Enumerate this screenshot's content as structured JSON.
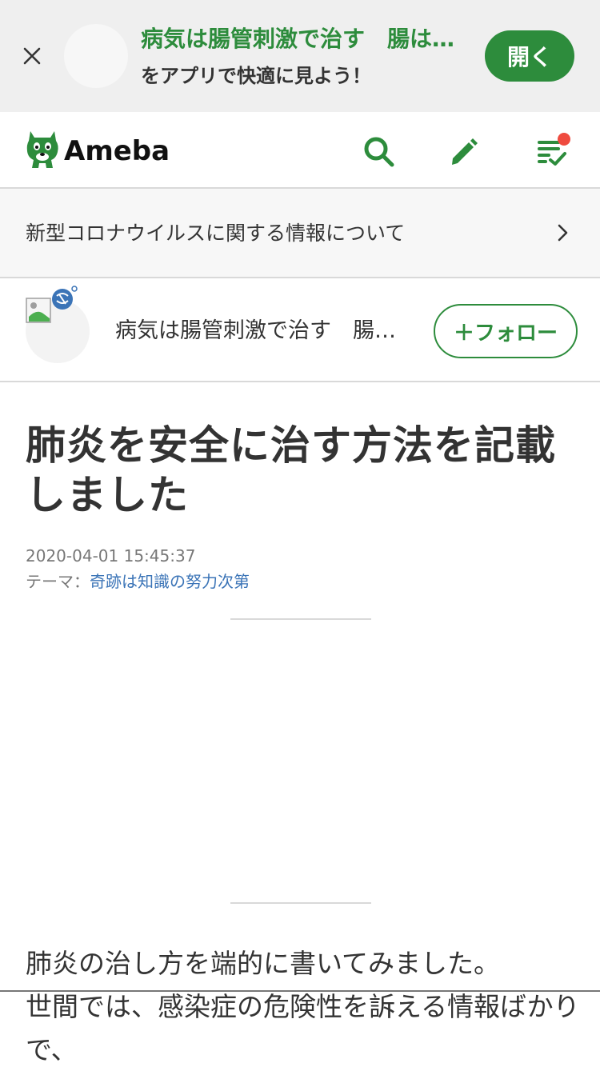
{
  "app_banner": {
    "title": "病気は腸管刺激で治す　腸は…",
    "subtitle": "をアプリで快適に見よう！",
    "open_label": "開く"
  },
  "header": {
    "logo_text": "Ameba",
    "icons": [
      "search-icon",
      "pencil-icon",
      "checklist-icon"
    ],
    "notification": true
  },
  "notice": {
    "text": "新型コロナウイルスに関する情報について"
  },
  "blogger": {
    "name": "病気は腸管刺激で治す　腸…",
    "follow_label": "＋フォロー"
  },
  "article": {
    "title": "肺炎を安全に治す方法を記載しました",
    "date": "2020-04-01 15:45:37",
    "theme_prefix": "テーマ：",
    "theme": "奇跡は知識の努力次第",
    "body": [
      "肺炎の治し方を端的に書いてみました。",
      "世間では、感染症の危険性を訴える情報ばかり",
      "で、"
    ]
  },
  "colors": {
    "brand_green": "#2d8c3c",
    "link_blue": "#3b74b7",
    "notification_red": "#ef4b3f"
  }
}
